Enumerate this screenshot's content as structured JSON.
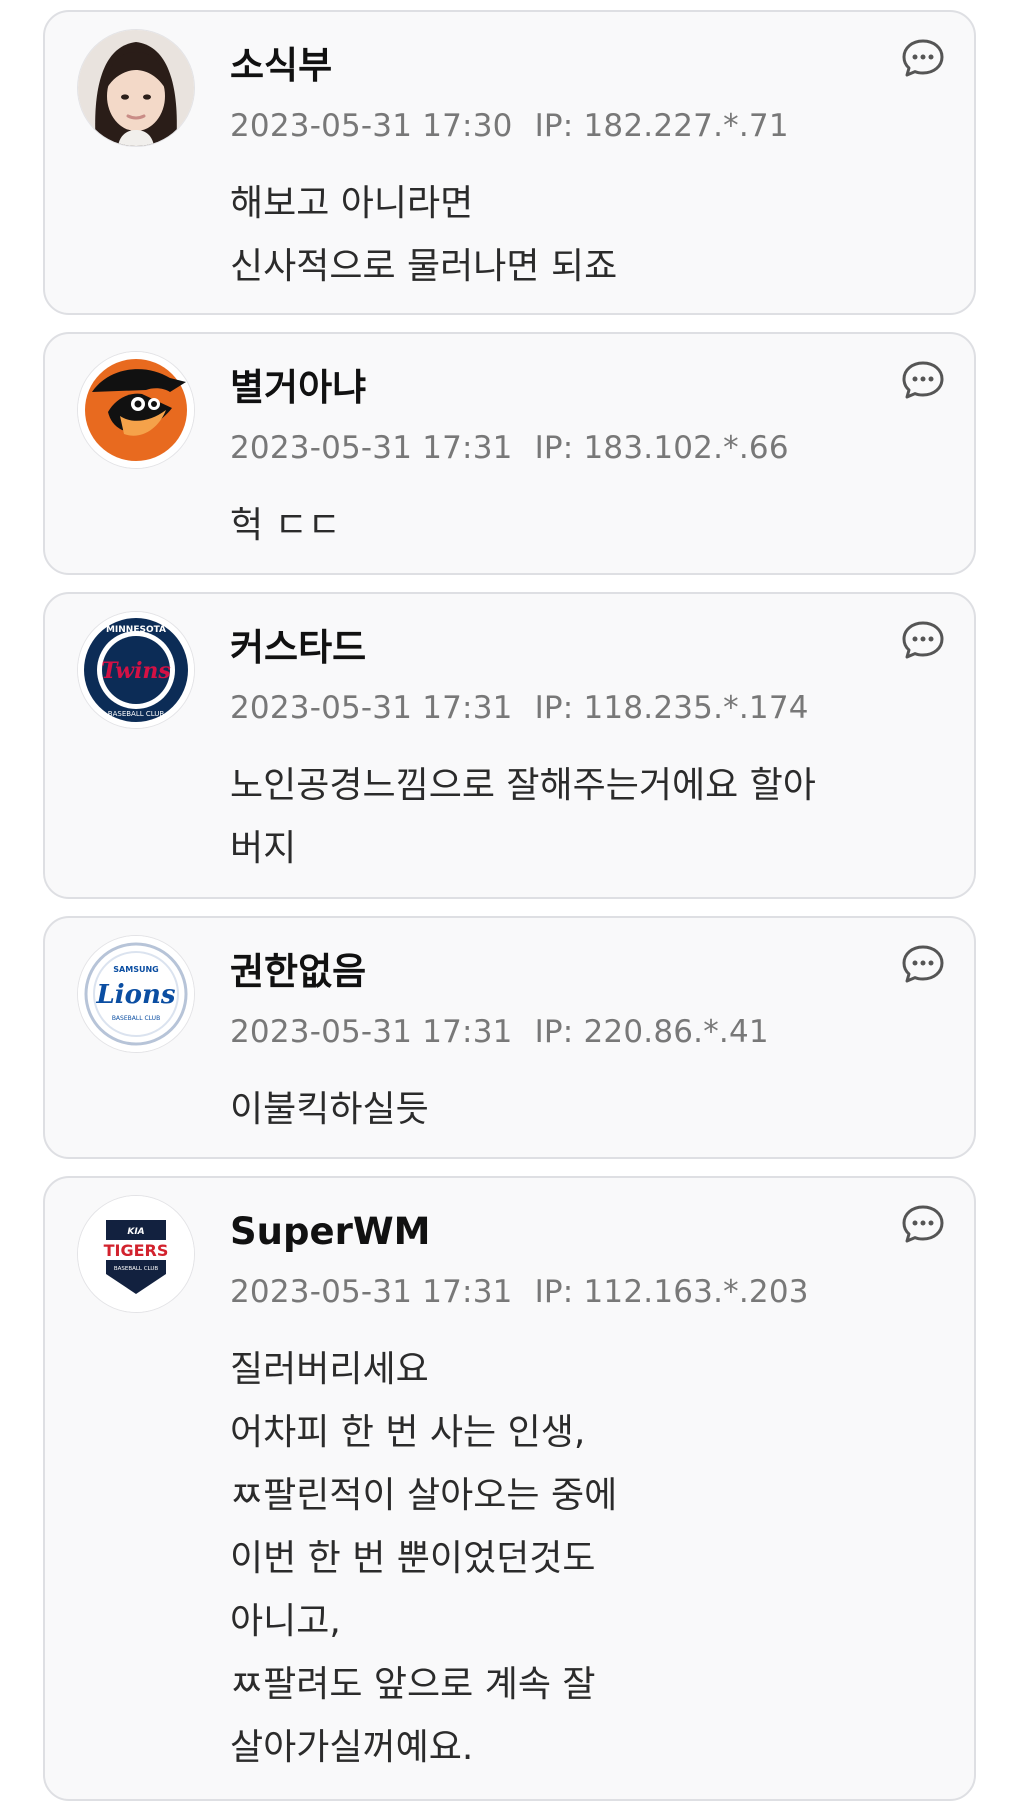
{
  "comments": [
    {
      "nickname": "소식부",
      "date": "2023-05-31 17:30",
      "ip": "IP: 182.227.*.71",
      "lines": [
        "해보고 아니라면",
        "신사적으로 물러나면 되죠"
      ],
      "avatar": "person-photo"
    },
    {
      "nickname": "별거아냐",
      "date": "2023-05-31 17:31",
      "ip": "IP: 183.102.*.66",
      "lines": [
        "헉 ㄷㄷ"
      ],
      "avatar": "orioles-logo"
    },
    {
      "nickname": "커스타드",
      "date": "2023-05-31 17:31",
      "ip": "IP: 118.235.*.174",
      "lines": [
        "노인공경느낌으로 잘해주는거에요 할아",
        "버지"
      ],
      "avatar": "twins-logo",
      "logo_text": {
        "ring": "MINNESOTA",
        "name": "Twins",
        "sub": "BASEBALL CLUB"
      }
    },
    {
      "nickname": "권한없음",
      "date": "2023-05-31 17:31",
      "ip": "IP: 220.86.*.41",
      "lines": [
        "이불킥하실듯"
      ],
      "avatar": "lions-logo",
      "logo_text": {
        "top": "SAMSUNG",
        "name": "Lions",
        "sub": "BASEBALL CLUB"
      }
    },
    {
      "nickname": "SuperWM",
      "date": "2023-05-31 17:31",
      "ip": "IP: 112.163.*.203",
      "lines": [
        "질러버리세요",
        "어차피 한 번 사는 인생,",
        "ㅉ팔린적이 살아오는 중에",
        "이번 한 번 뿐이었던것도",
        "아니고,",
        "ㅉ팔려도 앞으로 계속 잘",
        "살아가실꺼예요."
      ],
      "avatar": "tigers-logo",
      "logo_text": {
        "brand": "KIA",
        "name": "TIGERS",
        "sub": "BASEBALL CLUB"
      }
    }
  ],
  "colors": {
    "card_bg": "#f9f9fa",
    "card_border": "#dedfe3",
    "nickname": "#111111",
    "meta": "#787878",
    "body_text": "#2b2b2b"
  }
}
